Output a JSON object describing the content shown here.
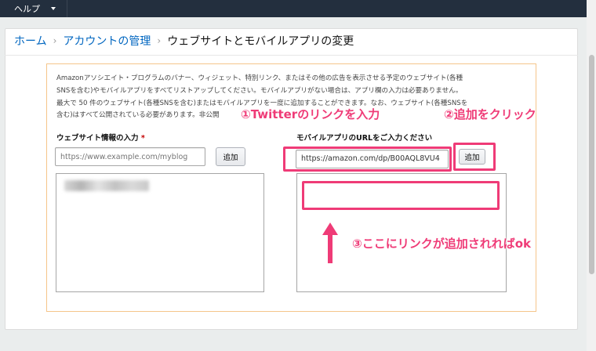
{
  "topbar": {
    "help_label": "ヘルプ"
  },
  "breadcrumb": {
    "home": "ホーム",
    "account": "アカウントの管理",
    "current": "ウェブサイトとモバイルアプリの変更"
  },
  "intro": {
    "line1": "Amazonアソシエイト・プログラムのバナー、ウィジェット、特別リンク、またはその他の広告を表示させる予定のウェブサイト(各種",
    "line2": "SNSを含む)やモバイルアプリをすべてリストアップしてください。モバイルアプリがない場合は、アプリ欄の入力は必要ありません。",
    "line3": "最大で 50 件のウェブサイト(各種SNSを含む)またはモバイルアプリを一度に追加することができます。なお、ウェブサイト(各種SNSを",
    "line4": "含む)はすべて公開されている必要があります。非公開"
  },
  "website": {
    "label": "ウェブサイト情報の入力",
    "required_mark": "*",
    "placeholder": "https://www.example.com/myblog",
    "add_label": "追加"
  },
  "mobile": {
    "label": "モバイルアプリのURLをご入力ください",
    "value": "https://amazon.com/dp/B00AQL8VU4",
    "add_label": "追加"
  },
  "annotations": {
    "step1": "①Twitterのリンクを入力",
    "step2": "②追加をクリック",
    "step3": "③ここにリンクが追加されればok"
  },
  "colors": {
    "accent_pink": "#ef3b77",
    "link_blue": "#0066c0",
    "topbar": "#232f3e",
    "form_border": "#f5c58a"
  }
}
